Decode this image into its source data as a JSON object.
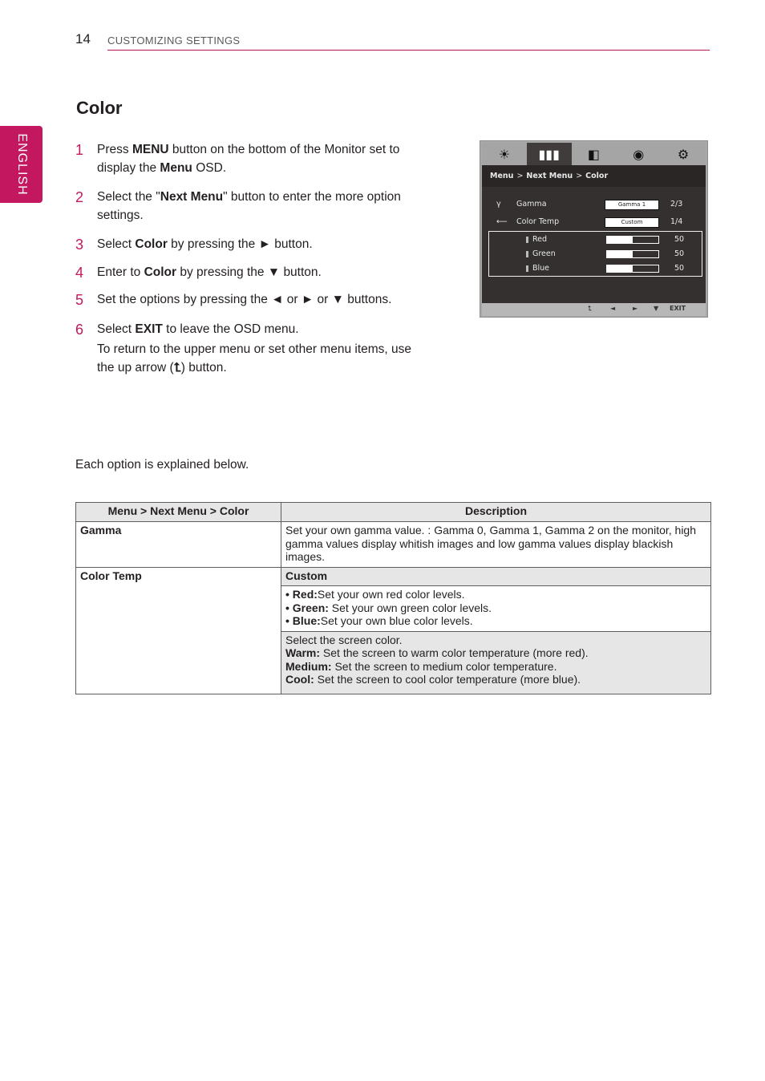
{
  "header": {
    "page_number": "14",
    "section_title": "CUSTOMIZING SETTINGS",
    "accent_color": "#c3185f"
  },
  "side_tab": {
    "label": "ENGLISH"
  },
  "title": "Color",
  "steps": [
    {
      "num": "1",
      "parts": [
        [
          "Press ",
          false
        ],
        [
          "MENU",
          true
        ],
        [
          " button on the bottom of the Monitor set to display the ",
          false
        ],
        [
          "Menu",
          true
        ],
        [
          " OSD.",
          false
        ]
      ]
    },
    {
      "num": "2",
      "parts": [
        [
          "Select the \"",
          false
        ],
        [
          "Next Menu",
          true
        ],
        [
          "\" button to enter the more option settings.",
          false
        ]
      ]
    },
    {
      "num": "3",
      "parts": [
        [
          "Select ",
          false
        ],
        [
          "Color",
          true
        ],
        [
          " by pressing the ► button.",
          false
        ]
      ]
    },
    {
      "num": "4",
      "parts": [
        [
          "Enter to ",
          false
        ],
        [
          "Color",
          true
        ],
        [
          " by pressing the ▼ button.",
          false
        ]
      ]
    },
    {
      "num": "5",
      "parts": [
        [
          "Set the options by pressing the ◄ or ► or ▼ buttons.",
          false
        ]
      ]
    },
    {
      "num": "6",
      "parts": [
        [
          "Select ",
          false
        ],
        [
          "EXIT",
          true
        ],
        [
          " to leave the OSD menu.",
          false
        ]
      ],
      "note_before": "To return to the upper menu or set other menu items, use the up arrow (",
      "note_icon": "up-arrow",
      "note_after": ") button."
    }
  ],
  "osd": {
    "tabs": [
      {
        "icon": "brightness-icon",
        "glyph": "☀",
        "active": false
      },
      {
        "icon": "color-bars-icon",
        "glyph": "▮▮▮",
        "active": true
      },
      {
        "icon": "picture-icon",
        "glyph": "◧",
        "active": false
      },
      {
        "icon": "disc-icon",
        "glyph": "◉",
        "active": false
      },
      {
        "icon": "settings-gear-icon",
        "glyph": "⚙",
        "active": false
      }
    ],
    "breadcrumb": [
      "Menu",
      "Next Menu",
      "Color"
    ],
    "breadcrumb_separator": ">",
    "rows": [
      {
        "icon": "gamma-icon",
        "glyph": "γ",
        "label": "Gamma",
        "value": "Gamma 1",
        "position": "2/3"
      },
      {
        "icon": "color-temp-icon",
        "glyph": "⟵",
        "label": "Color Temp",
        "value": "Custom",
        "position": "1/4"
      }
    ],
    "sub_rows": [
      {
        "label": "Red",
        "value": "50",
        "level_percent": 50
      },
      {
        "label": "Green",
        "value": "50",
        "level_percent": 50
      },
      {
        "label": "Blue",
        "value": "50",
        "level_percent": 50
      }
    ],
    "footer_buttons": [
      {
        "icon": "up-arrow-icon",
        "glyph": "⮤"
      },
      {
        "icon": "left-arrow-icon",
        "glyph": "◄"
      },
      {
        "icon": "right-arrow-icon",
        "glyph": "►"
      },
      {
        "icon": "down-arrow-icon",
        "glyph": "▼"
      },
      {
        "icon": "exit-label",
        "glyph": "EXIT"
      }
    ]
  },
  "intro_text": "Each option is explained below.",
  "table": {
    "headers": [
      "Menu > Next Menu > Color",
      "Description"
    ],
    "gamma": {
      "label": "Gamma",
      "description": "Set your own gamma value. : Gamma 0, Gamma 1, Gamma 2 on the monitor, high gamma values display whitish images and low gamma values display blackish images."
    },
    "color_temp": {
      "label": "Color Temp",
      "custom_heading": "Custom",
      "custom_items": [
        {
          "bold": "Red:",
          "text": "Set your own red color levels."
        },
        {
          "bold": "Green:",
          "text": " Set your own green color levels."
        },
        {
          "bold": "Blue:",
          "text": "Set your own blue color levels."
        }
      ],
      "preset_intro": "Select the screen color.",
      "presets": [
        {
          "bold": "Warm:",
          "text": " Set the screen to warm color temperature (more red)."
        },
        {
          "bold": "Medium:",
          "text": " Set the screen to medium color temperature."
        },
        {
          "bold": "Cool:",
          "text": " Set the screen to cool color temperature (more blue)."
        }
      ]
    }
  }
}
